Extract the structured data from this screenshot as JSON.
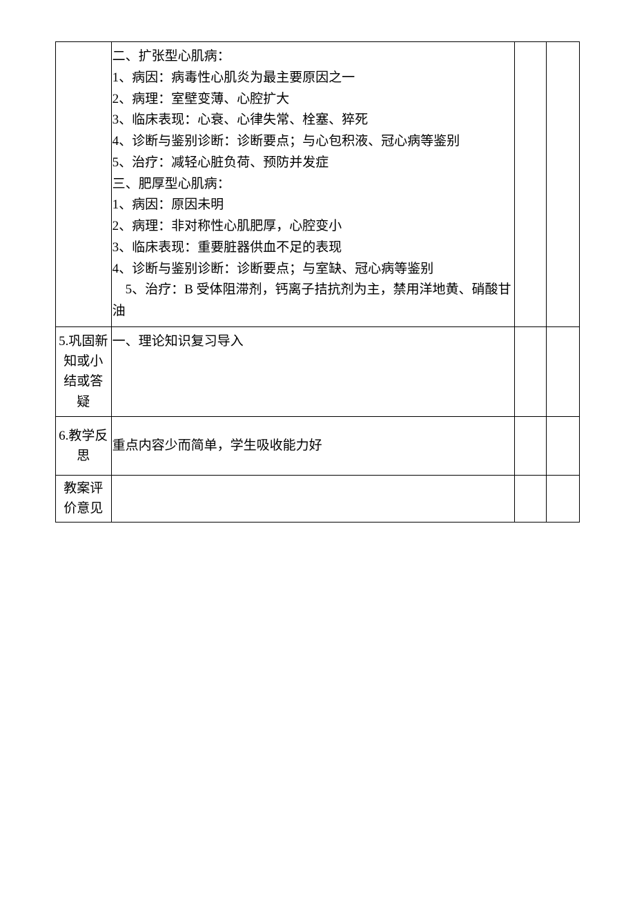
{
  "row4": {
    "lines": [
      "二、扩张型心肌病：",
      "1、病因：病毒性心肌炎为最主要原因之一",
      "2、病理：室壁变薄、心腔扩大",
      "3、临床表现：心衰、心律失常、栓塞、猝死",
      "4、诊断与鉴别诊断：诊断要点；与心包积液、冠心病等鉴别",
      "5、治疗：减轻心脏负荷、预防并发症",
      "三、肥厚型心肌病：",
      "1、病因：原因未明",
      "2、病理：非对称性心肌肥厚，心腔变小",
      "3、临床表现：重要脏器供血不足的表现",
      "4、诊断与鉴别诊断：诊断要点；与室缺、冠心病等鉴别"
    ],
    "indentLine": "　5、治疗：B 受体阻滞剂，钙离子拮抗剂为主，禁用洋地黄、硝酸甘油"
  },
  "row5": {
    "label_num": "5.",
    "label_text": "巩固新知或小结或答疑",
    "content": "一、理论知识复习导入"
  },
  "row6": {
    "label_num": "6.",
    "label_text": "教学反思",
    "content": "重点内容少而简单，学生吸收能力好"
  },
  "row7": {
    "label": "教案评价意见"
  }
}
